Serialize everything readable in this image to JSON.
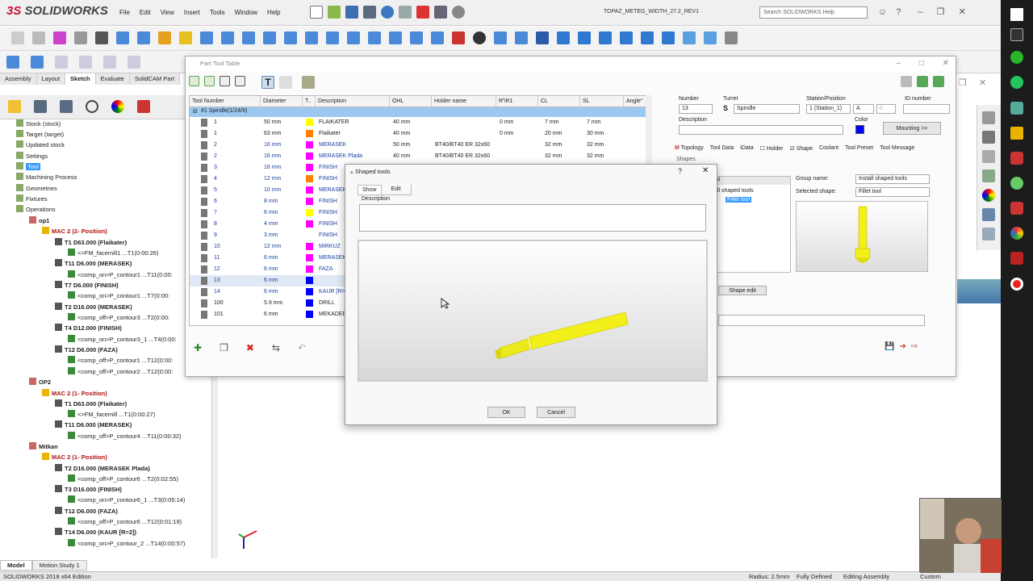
{
  "app": {
    "logo_prefix": "3S",
    "logo": "SOLIDWORKS",
    "menu": [
      "File",
      "Edit",
      "View",
      "Insert",
      "Tools",
      "Window",
      "Help"
    ],
    "document_title": "TOPAZ_METEG_WIDTH_27.2_REV1",
    "help_search_placeholder": "Search SOLIDWORKS Help"
  },
  "command_tabs": [
    "Assembly",
    "Layout",
    "Sketch",
    "Evaluate",
    "SolidCAM Part"
  ],
  "tree": {
    "rows": [
      {
        "label": "Stock (stock)",
        "indent": 1
      },
      {
        "label": "Target (target)",
        "indent": 1
      },
      {
        "label": "Updated stock",
        "indent": 1
      },
      {
        "label": "Settings",
        "indent": 1
      },
      {
        "label": "Tool",
        "indent": 1,
        "selected": true
      },
      {
        "label": "Machining Process",
        "indent": 1
      },
      {
        "label": "Geometries",
        "indent": 1
      },
      {
        "label": "Fixtures",
        "indent": 1
      },
      {
        "label": "Operations",
        "indent": 1
      },
      {
        "label": "op1",
        "indent": 2,
        "bold": true
      },
      {
        "label": "MAC 2 (2- Position)",
        "indent": 3,
        "red": true
      },
      {
        "label": "T1 D63.000 (Flaikater)",
        "indent": 4,
        "bold": true
      },
      {
        "label": "<>FM_facemill1 ...T1(0:00:26)",
        "indent": 5
      },
      {
        "label": "T11 D6.000 (MERASEK)",
        "indent": 4,
        "bold": true
      },
      {
        "label": "<comp_on>P_contour1 ...T11(0:00:",
        "indent": 5
      },
      {
        "label": "T7 D6.000 (FINISH)",
        "indent": 4,
        "bold": true
      },
      {
        "label": "<comp_on>P_contour1 ...T7(0:00:",
        "indent": 5
      },
      {
        "label": "T2 D16.000 (MERASEK)",
        "indent": 4,
        "bold": true
      },
      {
        "label": "<comp_off>P_contour3 ...T2(0:00:",
        "indent": 5
      },
      {
        "label": "T4 D12.000 (FINISH)",
        "indent": 4,
        "bold": true
      },
      {
        "label": "<comp_on>P_contour3_1 ...T4(0:00:",
        "indent": 5
      },
      {
        "label": "T12 D6.000 (FAZA)",
        "indent": 4,
        "bold": true
      },
      {
        "label": "<comp_off>P_contour1 ...T12(0:00:",
        "indent": 5
      },
      {
        "label": "<comp_off>P_contour2 ...T12(0:00:",
        "indent": 5
      },
      {
        "label": "OP2",
        "indent": 2,
        "bold": true
      },
      {
        "label": "MAC 2 (1- Position)",
        "indent": 3,
        "red": true
      },
      {
        "label": "T1 D63.000 (Flaikater)",
        "indent": 4,
        "bold": true
      },
      {
        "label": "<>FM_facemill ...T1(0:00:27)",
        "indent": 5
      },
      {
        "label": "T11 D6.000 (MERASEK)",
        "indent": 4,
        "bold": true
      },
      {
        "label": "<comp_off>P_contour4 ...T11(0:00:32)",
        "indent": 5
      },
      {
        "label": "Mitkan",
        "indent": 2,
        "bold": true
      },
      {
        "label": "MAC 2 (1- Position)",
        "indent": 3,
        "red": true
      },
      {
        "label": "T2 D16.000 (MERASEK Plada)",
        "indent": 4,
        "bold": true
      },
      {
        "label": "<comp_off>P_contour6 ...T2(0:02:55)",
        "indent": 5
      },
      {
        "label": "T3 D16.000 (FINISH)",
        "indent": 4,
        "bold": true
      },
      {
        "label": "<comp_on>P_contour6_1 ...T3(0:05:14)",
        "indent": 5
      },
      {
        "label": "T12 D6.000 (FAZA)",
        "indent": 4,
        "bold": true
      },
      {
        "label": "<comp_off>P_contour6 ...T12(0:01:19)",
        "indent": 5
      },
      {
        "label": "T14 D6.000 (KAUR [R=2])",
        "indent": 4,
        "bold": true
      },
      {
        "label": "<comp_on>P_contour_2 ...T14(0:00:57)",
        "indent": 5
      }
    ]
  },
  "bottom_tabs": [
    "Model",
    "Motion Study 1"
  ],
  "status": {
    "edition": "SOLIDWORKS 2018 x64 Edition",
    "radius": "Radius: 2.5mm",
    "defined": "Fully Defined",
    "mode": "Editing Assembly",
    "units": "Custom"
  },
  "part_tool_table": {
    "title": "Part Tool Table",
    "columns": [
      "Tool Number",
      "Diameter",
      "T..",
      "Description",
      "OHL",
      "Holder name",
      "R'\\R1",
      "CL",
      "SL",
      "Angle°"
    ],
    "group_row": "#1 Spindle(1/24/9)",
    "rows": [
      {
        "num": "1",
        "dia": "50 mm",
        "color": "#ffff00",
        "desc": "FLAIKATER",
        "ohl": "40 mm",
        "holder": "",
        "r": "0 mm",
        "cl": "7 mm",
        "sl": "7 mm"
      },
      {
        "num": "1",
        "dia": "63 mm",
        "color": "#ff8000",
        "desc": "Flaikater",
        "ohl": "40 mm",
        "holder": "",
        "r": "0 mm",
        "cl": "20 mm",
        "sl": "30 mm"
      },
      {
        "num": "2",
        "dia": "16 mm",
        "color": "#ff00ff",
        "desc": "MERASEK",
        "ohl": "50 mm",
        "holder": "BT40/BT40 ER 32x60",
        "r": "",
        "cl": "32 mm",
        "sl": "32 mm"
      },
      {
        "num": "2",
        "dia": "16 mm",
        "color": "#ff00ff",
        "desc": "MERASEK Plada",
        "ohl": "40 mm",
        "holder": "BT40/BT40 ER 32x60",
        "r": "",
        "cl": "32 mm",
        "sl": "32 mm"
      },
      {
        "num": "3",
        "dia": "16 mm",
        "color": "#ff00ff",
        "desc": "FINISH",
        "ohl": "",
        "holder": "",
        "r": "",
        "cl": "",
        "sl": ""
      },
      {
        "num": "4",
        "dia": "12 mm",
        "color": "#ff8000",
        "desc": "FINISH",
        "ohl": "",
        "holder": "",
        "r": "",
        "cl": "",
        "sl": ""
      },
      {
        "num": "5",
        "dia": "10 mm",
        "color": "#ff00ff",
        "desc": "MERASEK",
        "ohl": "",
        "holder": "",
        "r": "",
        "cl": "",
        "sl": ""
      },
      {
        "num": "6",
        "dia": "8 mm",
        "color": "#ff00ff",
        "desc": "FINISH",
        "ohl": "",
        "holder": "",
        "r": "",
        "cl": "",
        "sl": ""
      },
      {
        "num": "7",
        "dia": "6 mm",
        "color": "#ffff00",
        "desc": "FINISH",
        "ohl": "",
        "holder": "",
        "r": "",
        "cl": "",
        "sl": ""
      },
      {
        "num": "8",
        "dia": "4 mm",
        "color": "#ff00ff",
        "desc": "FINISH",
        "ohl": "",
        "holder": "",
        "r": "",
        "cl": "",
        "sl": ""
      },
      {
        "num": "9",
        "dia": "3 mm",
        "color": "",
        "desc": "FINISH",
        "ohl": "",
        "holder": "",
        "r": "",
        "cl": "",
        "sl": ""
      },
      {
        "num": "10",
        "dia": "12 mm",
        "color": "#ff00ff",
        "desc": "MIRKUZ",
        "ohl": "",
        "holder": "",
        "r": "",
        "cl": "",
        "sl": ""
      },
      {
        "num": "11",
        "dia": "6 mm",
        "color": "#ff00ff",
        "desc": "MERASEK",
        "ohl": "",
        "holder": "",
        "r": "",
        "cl": "",
        "sl": ""
      },
      {
        "num": "12",
        "dia": "6 mm",
        "color": "#ff00ff",
        "desc": "FAZA",
        "ohl": "",
        "holder": "",
        "r": "",
        "cl": "",
        "sl": ""
      },
      {
        "num": "13",
        "dia": "6 mm",
        "color": "#0000ff",
        "desc": "",
        "ohl": "",
        "holder": "",
        "r": "",
        "cl": "",
        "sl": ""
      },
      {
        "num": "14",
        "dia": "6 mm",
        "color": "#0000ff",
        "desc": "KAUR [R=",
        "ohl": "",
        "holder": "",
        "r": "",
        "cl": "",
        "sl": ""
      },
      {
        "num": "100",
        "dia": "5.9 mm",
        "color": "#0000ff",
        "desc": "DRILL",
        "ohl": "",
        "holder": "",
        "r": "",
        "cl": "",
        "sl": ""
      },
      {
        "num": "101",
        "dia": "6 mm",
        "color": "#0000ff",
        "desc": "MEKADED",
        "ohl": "",
        "holder": "",
        "r": "",
        "cl": "",
        "sl": ""
      }
    ],
    "right": {
      "number_label": "Number",
      "number_value": "13",
      "turret_label": "Turret",
      "turret_value": "Spindle",
      "station_label": "Station/Position",
      "station_value": "1 (Station_1)",
      "station_letter": "A",
      "station_num": "0",
      "id_label": "ID number",
      "id_value": "",
      "description_label": "Description",
      "description_value": "",
      "color_label": "Color",
      "mounting_button": "Mounting >>",
      "tabs": [
        "Topology",
        "Tool Data",
        "iData",
        "Holder",
        "Shape",
        "Coolant",
        "Tool Preset",
        "Tool Message"
      ],
      "shapes_label": "Shapes",
      "tree_partial_top": "al",
      "tree_partial": "all shaped tools",
      "tree_selected": "Fillet tool",
      "group_name_label": "Group name:",
      "group_name_value": "Install shaped tools",
      "selected_shape_label": "Selected shape:",
      "selected_shape_value": "Fillet tool",
      "shape_edit_button": "Shape edit"
    }
  },
  "shaped_tools_dialog": {
    "title": "Shaped tools",
    "help_glyph": "?",
    "tabs": [
      "Show",
      "Edit"
    ],
    "description_label": "Description",
    "description_value": "",
    "ok": "OK",
    "cancel": "Cancel"
  },
  "colors": {
    "accent_blue": "#0a64c8",
    "selection": "#3399ff",
    "tool_yellow": "#f2ef1a",
    "dark_strip": "#1c1c1c"
  }
}
